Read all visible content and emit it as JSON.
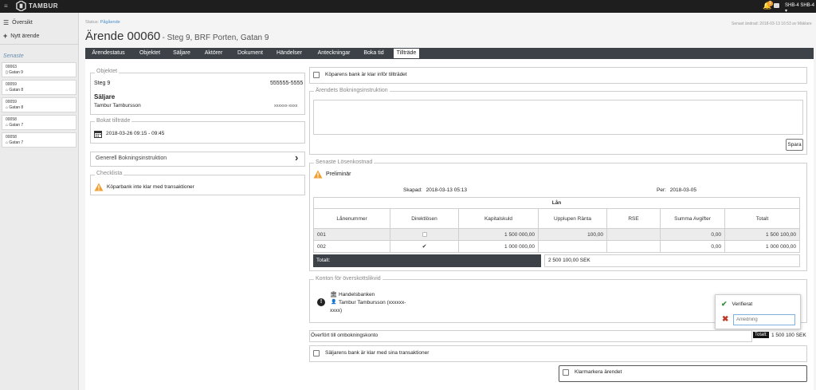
{
  "topbar": {
    "brand": "TAMBUR",
    "user": "SHB-4 SHB-4 ▾",
    "notification_count": "1"
  },
  "sidebar": {
    "overview": "Översikt",
    "new_case": "Nytt ärende",
    "recent_title": "Senaste",
    "recent": [
      {
        "id": "00063",
        "loc": "Gatan 9",
        "icon": "building"
      },
      {
        "id": "00059",
        "loc": "Gatan 8",
        "icon": "home"
      },
      {
        "id": "00059",
        "loc": "Gatan 8",
        "icon": "home"
      },
      {
        "id": "00058",
        "loc": "Gatan 7",
        "icon": "home"
      },
      {
        "id": "00058",
        "loc": "Gatan 7",
        "icon": "home"
      }
    ]
  },
  "header": {
    "status_label": "Status:",
    "status_value": "Pågående",
    "title_main": "Ärende 00060",
    "title_sub": "- Steg 9, BRF Porten, Gatan 9",
    "last_modified": "Senast ändrad: 2018-03-13 16:53 av Mäklare"
  },
  "tabs": [
    "Ärendestatus",
    "Objektet",
    "Säljare",
    "Aktörer",
    "Dokument",
    "Händelser",
    "Anteckningar",
    "Boka tid",
    "Tillträde"
  ],
  "objektet": {
    "legend": "Objektet",
    "name": "Steg 9",
    "code": "555555-5555",
    "seller_heading": "Säljare",
    "seller_name": "Tambur Tambursson",
    "seller_id": "xxxxxx-xxxx"
  },
  "booked": {
    "legend": "Bokat tillträde",
    "datetime": "2018-03-26 09:15 - 09:45"
  },
  "general": {
    "label": "Generell Bokningsinstruktion"
  },
  "checklist": {
    "legend": "Checklista",
    "item": "Köparbank inte klar med transaktioner"
  },
  "buyer_bank": {
    "label": "Köparens bank är klar inför tillträdet"
  },
  "booking_instruction": {
    "legend": "Ärendets Bokningsinstruktion",
    "save": "Spara"
  },
  "redemption": {
    "legend": "Senaste Lösenkostnad",
    "preliminary": "Preliminär",
    "created_label": "Skapad:",
    "created_value": "2018-03-13 05:13",
    "per_label": "Per:",
    "per_value": "2018-03-05",
    "table_title": "Lån",
    "columns": [
      "Lånenummer",
      "Direktlösen",
      "Kapitalskuld",
      "Upplupen Ränta",
      "RSE",
      "Summa Avgifter",
      "Totalt"
    ],
    "rows": [
      {
        "nr": "001",
        "direct": false,
        "capital": "1 500 000,00",
        "interest": "100,00",
        "rse": "",
        "fees": "0,00",
        "total": "1 500 100,00"
      },
      {
        "nr": "002",
        "direct": true,
        "capital": "1 000 000,00",
        "interest": "",
        "rse": "",
        "fees": "0,00",
        "total": "1 000 000,00"
      }
    ],
    "total_label": "Totalt:",
    "total_value": "2 500 100,00 SEK"
  },
  "surplus": {
    "legend": "Konton för överskottslikvid",
    "bank": "Handelsbanken",
    "holder": "Tambur Tambursson (xxxxxx-",
    "holder2": "xxxx)"
  },
  "popover": {
    "verified": "Verifierat",
    "reason_placeholder": "Anledning"
  },
  "transfer": {
    "label": "Överfört till ombokningskonto",
    "total_label": "Totalt:",
    "total_value": "1 500 100 SEK"
  },
  "seller_bank": {
    "label": "Säljarens bank är klar med sina transaktioner"
  },
  "mark_done": {
    "label": "Klarmarkera ärendet"
  },
  "colors": {
    "topbar": "#1e1e1e",
    "tabbar": "#3d4249",
    "link": "#4a90c9",
    "warning": "#f0a030",
    "verified": "#3c8c3c",
    "reject": "#c0392b",
    "badge": "#f0a030"
  }
}
